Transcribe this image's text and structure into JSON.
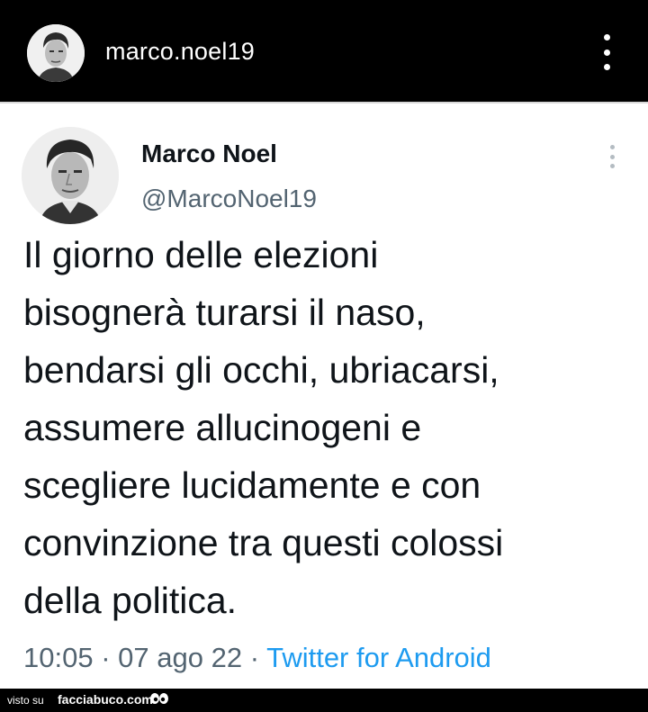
{
  "header": {
    "username": "marco.noel19",
    "avatar_icon": "profile-avatar",
    "more_icon": "vertical-ellipsis"
  },
  "tweet": {
    "display_name": "Marco Noel",
    "handle": "@MarcoNoel19",
    "text_lines": [
      "Il giorno delle elezioni",
      "bisognerà turarsi il naso,",
      "bendarsi gli occhi, ubriacarsi,",
      "assumere allucinogeni e",
      "scegliere lucidamente e con",
      "convinzione tra questi colossi",
      "della politica."
    ],
    "time": "10:05",
    "separator": "·",
    "date": "07 ago 22",
    "source": "Twitter for Android"
  },
  "footer": {
    "visto_su": "visto su",
    "site": "facciabuco.com"
  },
  "colors": {
    "background": "#000000",
    "card": "#ffffff",
    "text": "#0f1419",
    "muted": "#536471",
    "link": "#1d9bf0"
  }
}
